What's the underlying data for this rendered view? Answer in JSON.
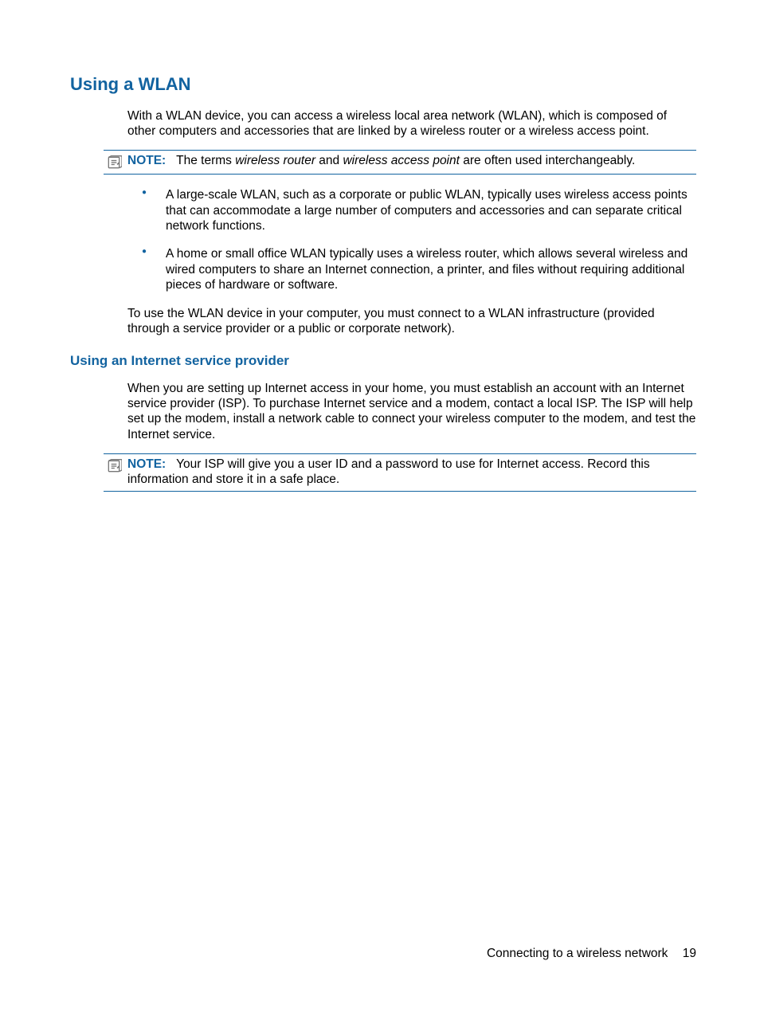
{
  "section": {
    "title": "Using a WLAN",
    "intro": "With a WLAN device, you can access a wireless local area network (WLAN), which is composed of other computers and accessories that are linked by a wireless router or a wireless access point."
  },
  "note1": {
    "label": "NOTE:",
    "prefix": "The terms ",
    "term1": "wireless router",
    "mid": " and ",
    "term2": "wireless access point",
    "suffix": " are often used interchangeably."
  },
  "bullets": {
    "item1": "A large-scale WLAN, such as a corporate or public WLAN, typically uses wireless access points that can accommodate a large number of computers and accessories and can separate critical network functions.",
    "item2": "A home or small office WLAN typically uses a wireless router, which allows several wireless and wired computers to share an Internet connection, a printer, and files without requiring additional pieces of hardware or software."
  },
  "para2": "To use the WLAN device in your computer, you must connect to a WLAN infrastructure (provided through a service provider or a public or corporate network).",
  "subsection": {
    "title": "Using an Internet service provider",
    "para": "When you are setting up Internet access in your home, you must establish an account with an Internet service provider (ISP). To purchase Internet service and a modem, contact a local ISP. The ISP will help set up the modem, install a network cable to connect your wireless computer to the modem, and test the Internet service."
  },
  "note2": {
    "label": "NOTE:",
    "text": "Your ISP will give you a user ID and a password to use for Internet access. Record this information and store it in a safe place."
  },
  "footer": {
    "chapter": "Connecting to a wireless network",
    "page": "19"
  }
}
